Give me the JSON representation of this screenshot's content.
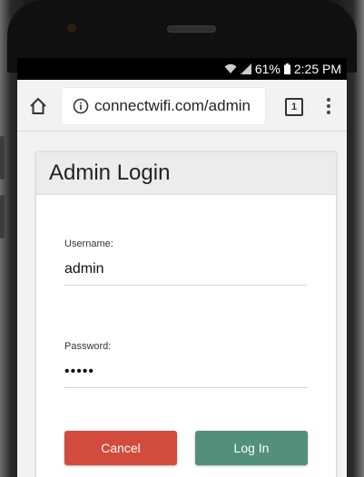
{
  "status": {
    "battery": "61%",
    "time": "2:25 PM"
  },
  "browser": {
    "url": "connectwifi.com/admin",
    "tab_count": "1"
  },
  "login": {
    "title": "Admin Login",
    "username_label": "Username:",
    "username_value": "admin",
    "password_label": "Password:",
    "password_value": "•••••",
    "cancel_label": "Cancel",
    "login_label": "Log In"
  },
  "colors": {
    "cancel": "#d34b3c",
    "login": "#52907b"
  }
}
